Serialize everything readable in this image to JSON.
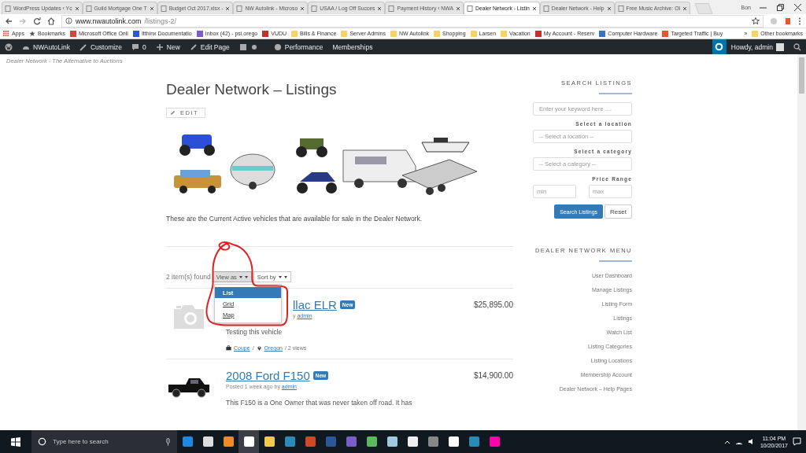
{
  "browser": {
    "tabs": [
      {
        "title": "WordPress Updates ‹ Yc",
        "selected": false
      },
      {
        "title": "Guild Mortgage One T",
        "selected": false
      },
      {
        "title": "Budget Oct 2017.xlsx -",
        "selected": false
      },
      {
        "title": "NW Autolink - Microso",
        "selected": false
      },
      {
        "title": "USAA / Log Off Succes",
        "selected": false
      },
      {
        "title": "Payment History ‹ NWA",
        "selected": false
      },
      {
        "title": "Dealer Network - Listin",
        "selected": true
      },
      {
        "title": "Dealer Network - Help",
        "selected": false
      },
      {
        "title": "Free Music Archive: Ol",
        "selected": false
      }
    ],
    "profile": "Bon",
    "url_host": "www.nwautolink.com",
    "url_path": "/listings-2/",
    "bookmarks": [
      {
        "label": "Apps",
        "kind": "apps"
      },
      {
        "label": "Bookmarks",
        "kind": "star"
      },
      {
        "label": "Microsoft Office Onli",
        "kind": "site"
      },
      {
        "label": "Itthinx Documentatio",
        "kind": "site"
      },
      {
        "label": "Inbox (42) - psi.orego",
        "kind": "site"
      },
      {
        "label": "VUDU",
        "kind": "site"
      },
      {
        "label": "Bills & Finance",
        "kind": "folder"
      },
      {
        "label": "Server Admins",
        "kind": "folder"
      },
      {
        "label": "NW Autolink",
        "kind": "folder"
      },
      {
        "label": "Shopping",
        "kind": "folder"
      },
      {
        "label": "Larsen",
        "kind": "folder"
      },
      {
        "label": "Vacation",
        "kind": "folder"
      },
      {
        "label": "My Account - Reserv",
        "kind": "site"
      },
      {
        "label": "Computer Hardware",
        "kind": "site"
      },
      {
        "label": "Targeted Traffic | Buy",
        "kind": "site"
      }
    ],
    "more_bookmarks": "»",
    "other_bookmarks": "Other bookmarks"
  },
  "admin_bar": {
    "site": "NWAutoLink",
    "customize": "Customize",
    "comments": "0",
    "new": "New",
    "edit_page": "Edit Page",
    "performance": "Performance",
    "memberships": "Memberships",
    "howdy": "Howdy, admin"
  },
  "tagline": "Dealer Network - The Alternative to Auctions",
  "page": {
    "title": "Dealer Network – Listings",
    "edit": "EDIT",
    "intro": "These are the Current Active vehicles that are available for sale in the Dealer Network.",
    "count": "2 item(s) found",
    "view_as": "View as",
    "sort_by": "Sort by",
    "view_menu": {
      "expanded": true,
      "options": [
        {
          "label": "List",
          "selected": true
        },
        {
          "label": "Grid",
          "selected": false
        },
        {
          "label": "Map",
          "selected": false
        }
      ]
    },
    "listings": [
      {
        "kind": "camera",
        "title": "llac ELR",
        "badge": "New",
        "byline": "y",
        "author": "admin",
        "price": "$25,895.00",
        "description": "Testing this vehicle",
        "category": "Coupe",
        "sep1": "/",
        "location": "Oregon",
        "views": "/ 2 views"
      },
      {
        "kind": "truck",
        "title": "2008 Ford F150",
        "badge": "New",
        "byline": "Posted 1 week ago by",
        "author": "admin",
        "price": "$14,900.00",
        "description": "This F150 is a One Owner that was never taken off road.  It has"
      }
    ]
  },
  "sidebar": {
    "search_heading": "SEARCH LISTINGS",
    "keyword_placeholder": "Enter your keyword here ....",
    "location_label": "Select a location",
    "location_value": "-- Select a location --",
    "category_label": "Select a category",
    "category_value": "-- Select a category --",
    "price_label": "Price Range",
    "min_placeholder": "min",
    "max_placeholder": "max",
    "search_button": "Search Listings",
    "reset_button": "Reset",
    "menu_heading": "DEALER NETWORK MENU",
    "menu": [
      "User Dashboard",
      "Manage Listings",
      "Listing Form",
      "Listings",
      "Watch List",
      "Listing Categories",
      "Listing Locations",
      "Membership Account",
      "Dealer Network – Help Pages"
    ]
  },
  "taskbar": {
    "search_placeholder": "Type here to search",
    "time": "11:04 PM",
    "date": "10/20/2017"
  }
}
